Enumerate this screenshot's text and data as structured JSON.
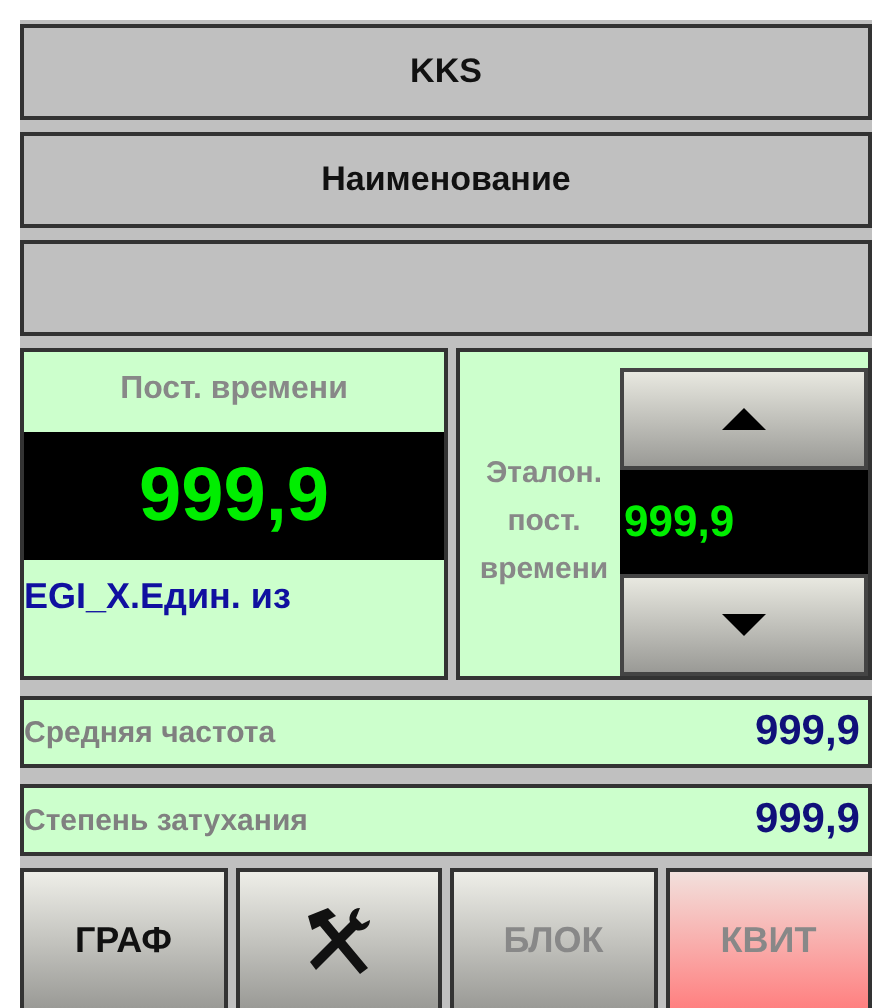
{
  "header": {
    "kks": "KKS",
    "name": "Наименование"
  },
  "time_constant": {
    "label": "Пост. времени",
    "value": "999,9",
    "tag": "EGI_X.Един. из"
  },
  "reference": {
    "label": "Эталон. пост. времени",
    "value": "999,9"
  },
  "readings": [
    {
      "label": "Средняя частота",
      "value": "999,9"
    },
    {
      "label": "Степень затухания",
      "value": "999,9"
    }
  ],
  "buttons": [
    {
      "kind": "text",
      "label": "ГРАФ",
      "disabled": false,
      "alarm": false
    },
    {
      "kind": "icon",
      "disabled": false,
      "alarm": false
    },
    {
      "kind": "text",
      "label": "БЛОК",
      "disabled": true,
      "alarm": false
    },
    {
      "kind": "text",
      "label": "КВИТ",
      "disabled": true,
      "alarm": true
    }
  ]
}
